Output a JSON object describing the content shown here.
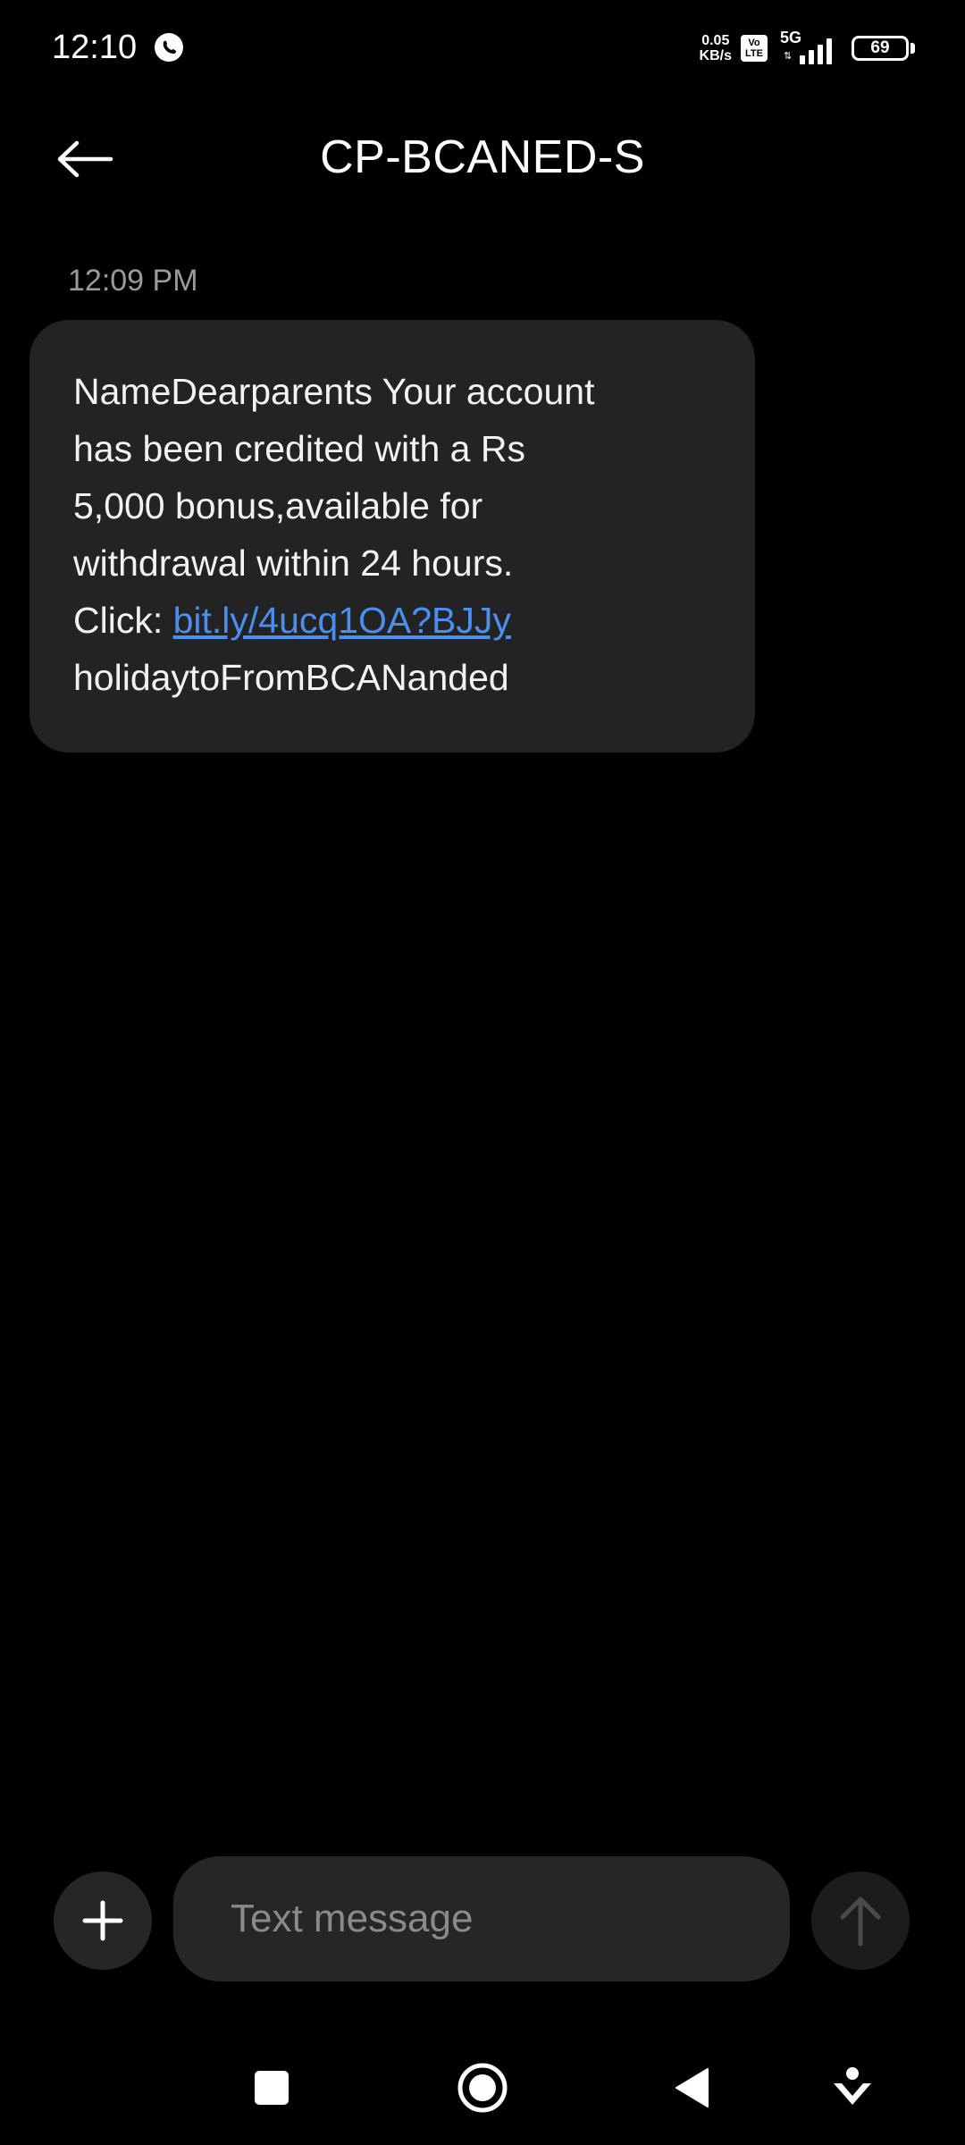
{
  "status_bar": {
    "time": "12:10",
    "net_speed_value": "0.05",
    "net_speed_unit": "KB/s",
    "volte_top": "Vo",
    "volte_bottom": "LTE",
    "network_type": "5G",
    "battery_level": "69",
    "app_icon": "whatsapp-icon"
  },
  "header": {
    "title": "CP-BCANED-S",
    "back_icon": "arrow-left-icon"
  },
  "messages": [
    {
      "timestamp": "12:09 PM",
      "lines": [
        "NameDearparents Your account",
        "has been credited with a Rs",
        "5,000 bonus,available for",
        "withdrawal within 24 hours."
      ],
      "link_prefix": "Click: ",
      "link_text": "bit.ly/4ucq1OA?BJJy",
      "last_line": "holidaytoFromBCANanded"
    }
  ],
  "composer": {
    "placeholder": "Text message",
    "attach_icon": "plus-icon",
    "send_icon": "arrow-up-icon"
  },
  "nav_bar": {
    "recents_icon": "square-icon",
    "home_icon": "circle-icon",
    "back_icon": "triangle-left-icon",
    "assist_icon": "person-download-icon"
  },
  "colors": {
    "background": "#000000",
    "bubble": "#232323",
    "link": "#4a8ff0",
    "secondary_text": "#9a9a9a",
    "input_background": "#262626"
  }
}
